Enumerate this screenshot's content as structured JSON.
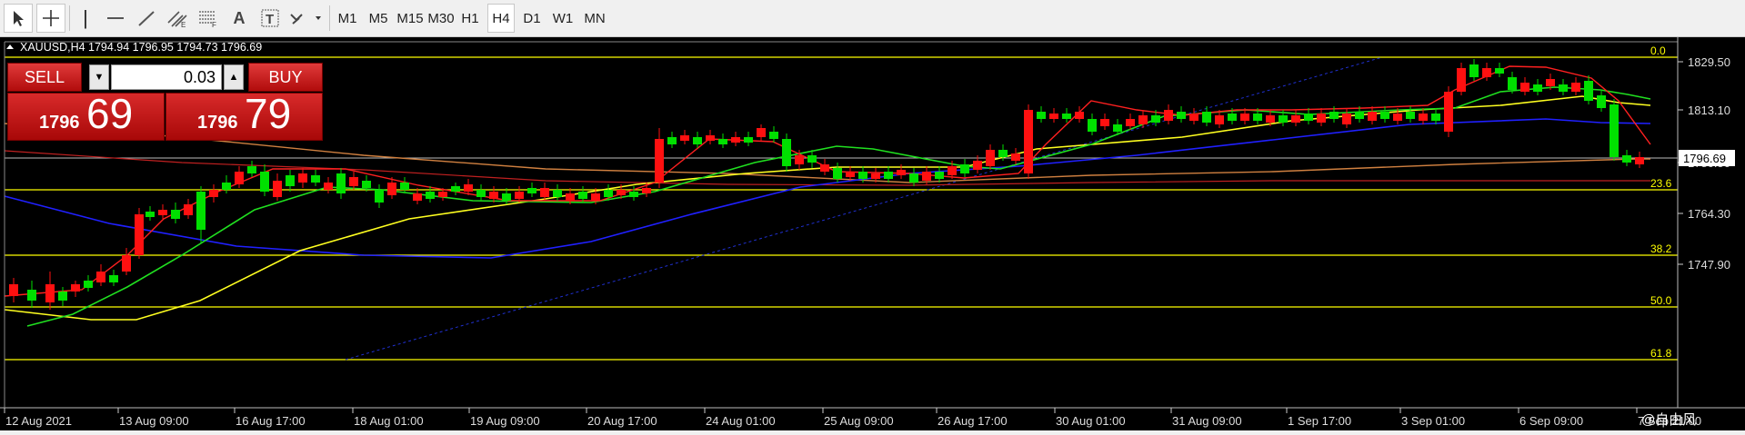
{
  "toolbar": {
    "line_tool": "|",
    "hline_tool": "—",
    "text_tool": "A",
    "label_tool": "T",
    "fibo_sub": "E",
    "fibo_sub2": "F",
    "timeframes": [
      "M1",
      "M5",
      "M15",
      "M30",
      "H1",
      "H4",
      "D1",
      "W1",
      "MN"
    ],
    "active_timeframe": "H4"
  },
  "chart": {
    "header": "XAUUSD,H4  1794.94 1796.95 1794.73 1796.69",
    "current_price": "1796.69",
    "price_scale": [
      "1829.50",
      "1813.10",
      "1796.69",
      "1780.50",
      "1764.30",
      "1747.90"
    ],
    "fib_levels": [
      "0.0",
      "23.6",
      "38.2",
      "50.0",
      "61.8"
    ],
    "time_labels": [
      "12 Aug 2021",
      "13 Aug 09:00",
      "16 Aug 17:00",
      "18 Aug 01:00",
      "19 Aug 09:00",
      "20 Aug 17:00",
      "24 Aug 01:00",
      "25 Aug 09:00",
      "26 Aug 17:00",
      "30 Aug 01:00",
      "31 Aug 09:00",
      "1 Sep 17:00",
      "3 Sep 01:00",
      "6 Sep 09:00",
      "7 Sep 21:00"
    ],
    "watermark": "@自由风"
  },
  "trade_panel": {
    "sell_label": "SELL",
    "buy_label": "BUY",
    "lot": "0.03",
    "sell_big_prefix": "1796",
    "sell_big": "69",
    "buy_big_prefix": "1796",
    "buy_big": "79",
    "spin_down": "▼",
    "spin_up": "▲"
  },
  "colors": {
    "bull": "#00e000",
    "bear": "#ff1010",
    "fib": "#ffff00",
    "ma_red": "#ff2020",
    "ma_green": "#20e020",
    "ma_yellow": "#ffff20",
    "ma_blue": "#2020ff"
  }
}
